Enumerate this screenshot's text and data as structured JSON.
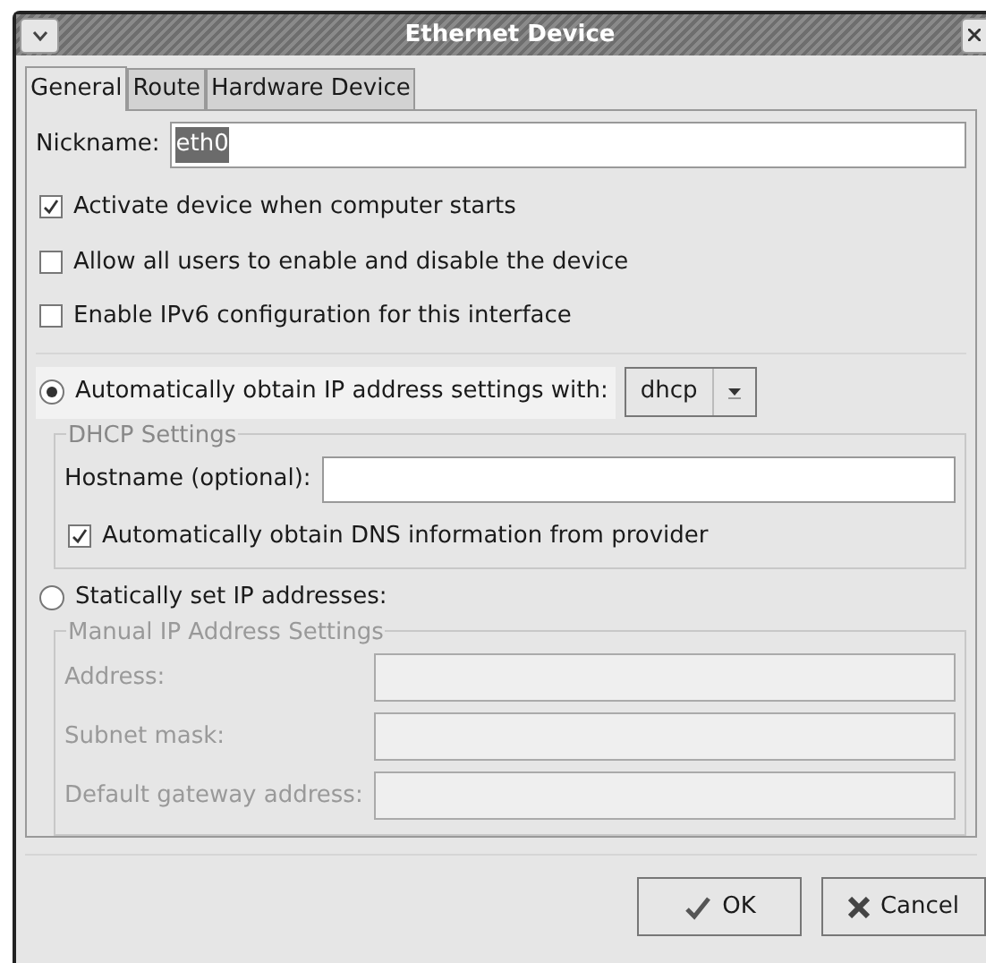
{
  "window": {
    "title": "Ethernet Device"
  },
  "tabs": [
    {
      "label": "General",
      "selected": true
    },
    {
      "label": "Route",
      "selected": false
    },
    {
      "label": "Hardware Device",
      "selected": false
    }
  ],
  "nickname": {
    "label": "Nickname:",
    "value": "eth0",
    "selected": true
  },
  "options": [
    {
      "label": "Activate device when computer starts",
      "checked": true
    },
    {
      "label": "Allow all users to enable and disable the device",
      "checked": false
    },
    {
      "label": "Enable IPv6 configuration for this interface",
      "checked": false
    }
  ],
  "auto_ip": {
    "label": "Automatically obtain IP address settings with:",
    "selected": true,
    "hover": true,
    "protocol": "dhcp"
  },
  "dhcp_settings": {
    "title": "DHCP Settings",
    "disabled": false,
    "hostname_label": "Hostname (optional):",
    "dns": {
      "label": "Automatically obtain DNS information from provider",
      "checked": true
    }
  },
  "static_ip": {
    "label": "Statically set IP addresses:",
    "selected": false,
    "hover": false
  },
  "manual_settings": {
    "title": "Manual IP Address Settings",
    "disabled": true,
    "fields": [
      {
        "label": "Address:"
      },
      {
        "label": "Subnet mask:"
      },
      {
        "label": "Default gateway address:"
      }
    ]
  },
  "buttons": [
    {
      "label": "OK",
      "kind": "ok"
    },
    {
      "label": "Cancel",
      "kind": "cancel"
    }
  ]
}
